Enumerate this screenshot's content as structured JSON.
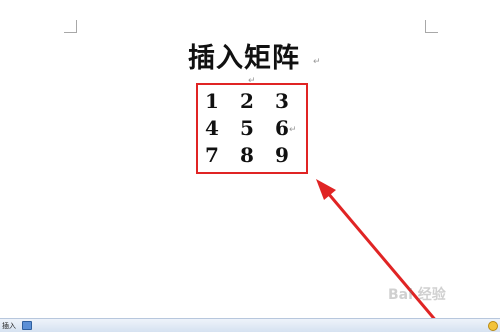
{
  "document": {
    "title": "插入矩阵",
    "para_mark": "↵",
    "matrix": [
      [
        "1",
        "2",
        "3"
      ],
      [
        "4",
        "5",
        "6"
      ],
      [
        "7",
        "8",
        "9"
      ]
    ]
  },
  "annotation": {
    "highlight_color": "#e02424",
    "arrow_color": "#e02424"
  },
  "statusbar": {
    "mode_label": "插入"
  },
  "watermark": {
    "text": "Bai 经验"
  }
}
